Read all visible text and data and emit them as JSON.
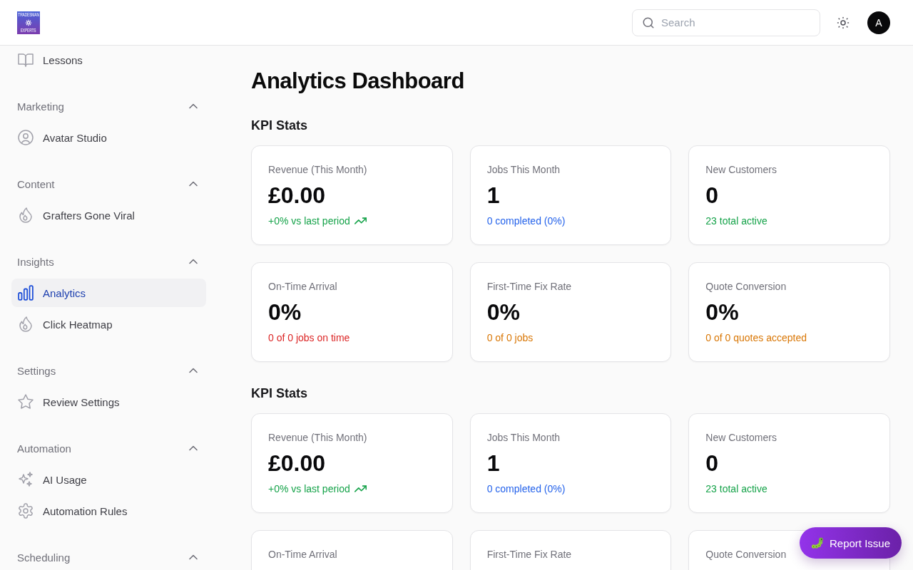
{
  "header": {
    "logo": {
      "top_text": "TRADESMAN",
      "bottom_text": "EXPERTS"
    },
    "search": {
      "placeholder": "Search"
    },
    "avatar": {
      "initial": "A"
    }
  },
  "sidebar": {
    "sections": [
      {
        "items": [
          {
            "label": "Lessons",
            "selected": false
          }
        ]
      },
      {
        "title": "Marketing",
        "expanded": true,
        "items": [
          {
            "label": "Avatar Studio",
            "selected": false
          }
        ]
      },
      {
        "title": "Content",
        "expanded": true,
        "items": [
          {
            "label": "Grafters Gone Viral",
            "selected": false
          }
        ]
      },
      {
        "title": "Insights",
        "expanded": true,
        "items": [
          {
            "label": "Analytics",
            "selected": true
          },
          {
            "label": "Click Heatmap",
            "selected": false
          }
        ]
      },
      {
        "title": "Settings",
        "expanded": true,
        "items": [
          {
            "label": "Review Settings",
            "selected": false
          }
        ]
      },
      {
        "title": "Automation",
        "expanded": true,
        "items": [
          {
            "label": "AI Usage",
            "selected": false
          },
          {
            "label": "Automation Rules",
            "selected": false
          }
        ]
      },
      {
        "title": "Scheduling",
        "expanded": true
      }
    ]
  },
  "main": {
    "title": "Analytics Dashboard",
    "kpi_sections": [
      {
        "heading": "KPI Stats",
        "cards": [
          {
            "label": "Revenue (This Month)",
            "value": "£0.00",
            "note": "+0% vs last period",
            "color": "#16a34a",
            "trend_up": true
          },
          {
            "label": "Jobs This Month",
            "value": "1",
            "note": "0 completed (0%)",
            "color": "#2563eb",
            "trend_up": false
          },
          {
            "label": "New Customers",
            "value": "0",
            "note": "23 total active",
            "color": "#16a34a",
            "trend_up": false
          },
          {
            "label": "On-Time Arrival",
            "value": "0%",
            "note": "0 of 0 jobs on time",
            "color": "#dc2626",
            "trend_up": false
          },
          {
            "label": "First-Time Fix Rate",
            "value": "0%",
            "note": "0 of 0 jobs",
            "color": "#d97706",
            "trend_up": false
          },
          {
            "label": "Quote Conversion",
            "value": "0%",
            "note": "0 of 0 quotes accepted",
            "color": "#d97706",
            "trend_up": false
          }
        ]
      },
      {
        "heading": "KPI Stats",
        "cards": [
          {
            "label": "Revenue (This Month)",
            "value": "£0.00",
            "note": "+0% vs last period",
            "color": "#16a34a",
            "trend_up": true
          },
          {
            "label": "Jobs This Month",
            "value": "1",
            "note": "0 completed (0%)",
            "color": "#2563eb",
            "trend_up": false
          },
          {
            "label": "New Customers",
            "value": "0",
            "note": "23 total active",
            "color": "#16a34a",
            "trend_up": false
          },
          {
            "label": "On-Time Arrival"
          },
          {
            "label": "First-Time Fix Rate"
          },
          {
            "label": "Quote Conversion"
          }
        ]
      }
    ]
  },
  "report_button": {
    "label": "Report Issue"
  }
}
